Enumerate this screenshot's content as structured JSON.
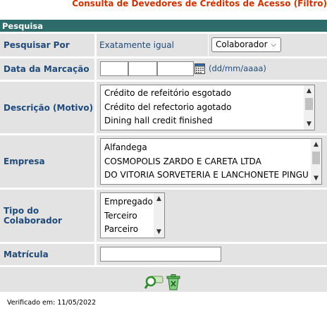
{
  "page": {
    "title": "Consulta de Devedores de Créditos de Acesso (Filtro)",
    "section": "Pesquisa"
  },
  "search_by": {
    "label": "Pesquisar Por",
    "mode": "Exatamente igual",
    "selected": "Colaborador"
  },
  "date": {
    "label": "Data da Marcação",
    "format_hint": "(dd/mm/aaaa)",
    "day": "",
    "month": "",
    "year": ""
  },
  "description": {
    "label": "Descrição (Motivo)",
    "items": [
      "Crédito de refeitório esgotado",
      "Crédito del refectorio agotado",
      "Dining hall credit finished"
    ]
  },
  "company": {
    "label": "Empresa",
    "items": [
      "Alfandega",
      "COSMOPOLIS ZARDO E CARETA LTDA",
      "DO VITORIA SORVETERIA E LANCHONETE PINGU"
    ]
  },
  "collaborator_type": {
    "label": "Tipo do Colaborador",
    "items": [
      "Empregado",
      "Terceiro",
      "Parceiro"
    ]
  },
  "registration": {
    "label": "Matrícula",
    "value": ""
  },
  "footer": {
    "verified": "Verificado em: 11/05/2022"
  },
  "icons": {
    "calendar": "calendar-icon",
    "search": "search-icon",
    "clear": "trash-icon"
  },
  "colors": {
    "title": "#cc3300",
    "header": "#2e6b6b",
    "label_text": "#1f4a7a",
    "row_bg": "#e3e3e3"
  }
}
